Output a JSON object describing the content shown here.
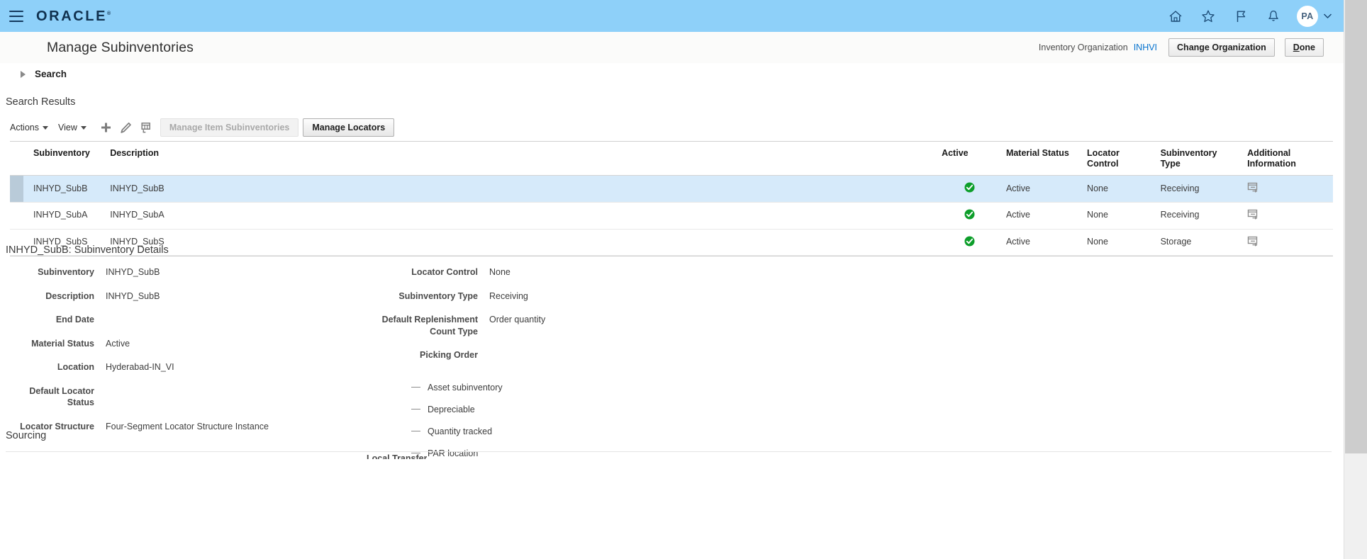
{
  "global_header": {
    "logo_text": "ORACLE",
    "menu_icon": "hamburger-icon",
    "icons": [
      {
        "name": "home-icon",
        "label": "Home"
      },
      {
        "name": "favorites-star-icon",
        "label": "Favorites and Recent Items"
      },
      {
        "name": "flag-icon",
        "label": "Watchlist"
      },
      {
        "name": "bell-icon",
        "label": "Notifications"
      }
    ],
    "avatar_initials": "PA",
    "accent_color": "#8ed0f9"
  },
  "title_bar": {
    "page_title": "Manage Subinventories",
    "inventory_organization_label": "Inventory Organization",
    "inventory_organization_value": "INHVI",
    "change_organization_button": "Change Organization",
    "done_button": "Done",
    "link_color": "#0572ce"
  },
  "search_section": {
    "label": "Search",
    "expanded": false
  },
  "search_results": {
    "heading": "Search Results",
    "toolbar": {
      "actions_label": "Actions",
      "view_label": "View",
      "add_icon": "plus-icon",
      "edit_icon": "pencil-icon",
      "detach_icon": "detach-table-icon",
      "manage_item_subinventories_button": "Manage Item Subinventories",
      "manage_item_subinventories_enabled": false,
      "manage_locators_button": "Manage Locators",
      "manage_locators_enabled": true
    },
    "columns": [
      "Subinventory",
      "Description",
      "Active",
      "Material Status",
      "Locator Control",
      "Subinventory Type",
      "Additional Information"
    ],
    "rows": [
      {
        "subinventory": "INHYD_SubB",
        "description": "INHYD_SubB",
        "active": "checked",
        "material_status": "Active",
        "locator_control": "None",
        "subinventory_type": "Receiving",
        "additional_information": "note-icon",
        "selected": true
      },
      {
        "subinventory": "INHYD_SubA",
        "description": "INHYD_SubA",
        "active": "checked",
        "material_status": "Active",
        "locator_control": "None",
        "subinventory_type": "Receiving",
        "additional_information": "note-icon",
        "selected": false
      },
      {
        "subinventory": "INHYD_SubS",
        "description": "INHYD_SubS",
        "active": "checked",
        "material_status": "Active",
        "locator_control": "None",
        "subinventory_type": "Storage",
        "additional_information": "note-icon",
        "selected": false
      }
    ],
    "active_check_color": "#0d9e2a"
  },
  "details": {
    "heading": "INHYD_SubB: Subinventory Details",
    "left_fields": [
      {
        "label": "Subinventory",
        "value": "INHYD_SubB"
      },
      {
        "label": "Description",
        "value": "INHYD_SubB"
      },
      {
        "label": "End Date",
        "value": ""
      },
      {
        "label": "Material Status",
        "value": "Active"
      },
      {
        "label": "Location",
        "value": "Hyderabad-IN_VI"
      },
      {
        "label": "Default Locator Status",
        "value": ""
      },
      {
        "label": "Locator Structure",
        "value": "Four-Segment Locator Structure Instance"
      }
    ],
    "right_fields": [
      {
        "label": "Locator Control",
        "value": "None"
      },
      {
        "label": "Subinventory Type",
        "value": "Receiving"
      },
      {
        "label": "Default Replenishment Count Type",
        "value": "Order quantity"
      },
      {
        "label": "Picking Order",
        "value": ""
      }
    ],
    "flags": [
      {
        "label": "Asset subinventory",
        "value": "—"
      },
      {
        "label": "Depreciable",
        "value": "—"
      },
      {
        "label": "Quantity tracked",
        "value": "—"
      },
      {
        "label": "PAR location",
        "value": "—"
      }
    ]
  },
  "sourcing": {
    "heading": "Sourcing",
    "cutoff_label": "Local Transfer"
  }
}
